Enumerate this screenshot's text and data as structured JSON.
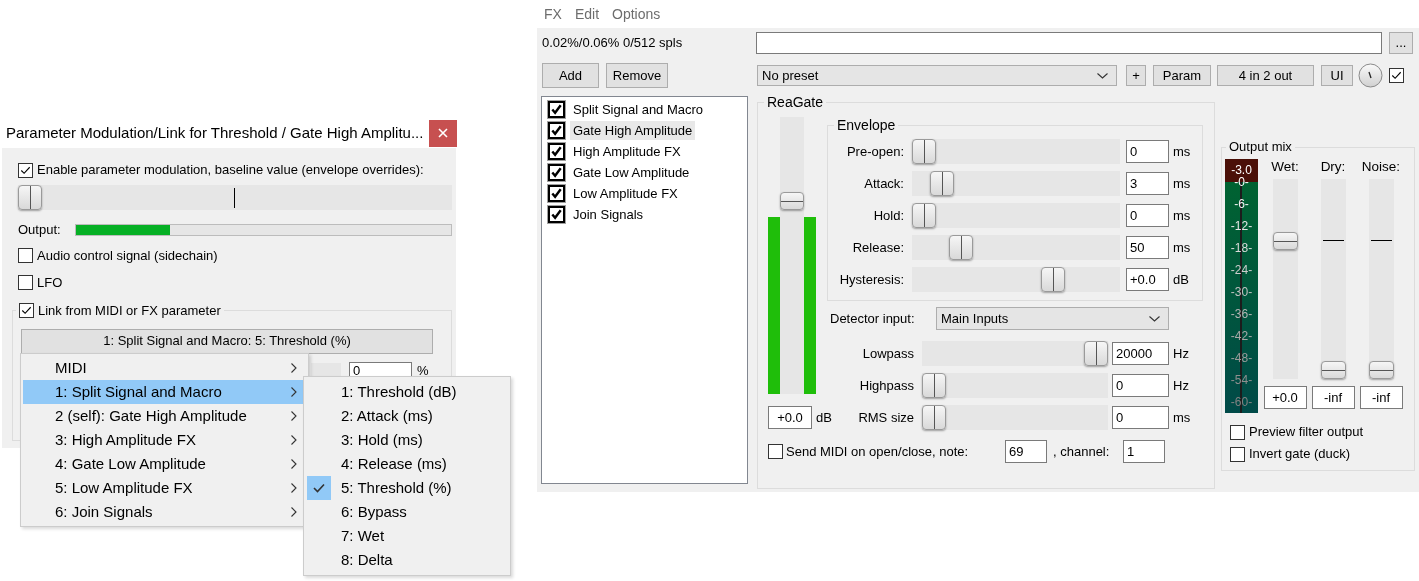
{
  "param_dialog": {
    "title": "Parameter Modulation/Link for Threshold / Gate High Amplitu...",
    "enable_modulation": {
      "label": "Enable parameter modulation, baseline value (envelope overrides):",
      "checked": true
    },
    "baseline": {
      "level": 0
    },
    "output": {
      "label": "Output:",
      "level": 0.25
    },
    "audio_control": {
      "label": "Audio control signal (sidechain)",
      "checked": false
    },
    "lfo": {
      "label": "LFO",
      "checked": false
    },
    "link": {
      "label": "Link from MIDI or FX parameter",
      "checked": true
    },
    "link_source_button": "1: Split Signal and Macro: 5: Threshold (%)",
    "offset": {
      "value": "0",
      "unit": "%"
    }
  },
  "link_menu": {
    "items": [
      {
        "label": "MIDI",
        "selected": false
      },
      {
        "label": "1: Split Signal and Macro",
        "selected": true
      },
      {
        "label": "2 (self): Gate High Amplitude",
        "selected": false
      },
      {
        "label": "3: High Amplitude FX",
        "selected": false
      },
      {
        "label": "4: Gate Low Amplitude",
        "selected": false
      },
      {
        "label": "5: Low Amplitude FX",
        "selected": false
      },
      {
        "label": "6: Join Signals",
        "selected": false
      }
    ]
  },
  "param_submenu": {
    "items": [
      {
        "label": "1: Threshold (dB)",
        "checked": false
      },
      {
        "label": "2: Attack (ms)",
        "checked": false
      },
      {
        "label": "3: Hold (ms)",
        "checked": false
      },
      {
        "label": "4: Release (ms)",
        "checked": false
      },
      {
        "label": "5: Threshold (%)",
        "checked": true
      },
      {
        "label": "6: Bypass",
        "checked": false
      },
      {
        "label": "7: Wet",
        "checked": false
      },
      {
        "label": "8: Delta",
        "checked": false
      }
    ]
  },
  "fx_window": {
    "menu": [
      "FX",
      "Edit",
      "Options"
    ],
    "cpu": "0.02%/0.06% 0/512 spls",
    "browse_button": "...",
    "add_button": "Add",
    "remove_button": "Remove",
    "preset": "No preset",
    "plus_button": "+",
    "param_button": "Param",
    "io_button": "4 in 2 out",
    "ui_button": "UI",
    "enabled": true,
    "fx_list": [
      {
        "name": "Split Signal and Macro",
        "enabled": true,
        "selected": false
      },
      {
        "name": "Gate High Amplitude",
        "enabled": true,
        "selected": true
      },
      {
        "name": "High Amplitude FX",
        "enabled": true,
        "selected": false
      },
      {
        "name": "Gate Low Amplitude",
        "enabled": true,
        "selected": false
      },
      {
        "name": "Low Amplitude FX",
        "enabled": true,
        "selected": false
      },
      {
        "name": "Join Signals",
        "enabled": true,
        "selected": false
      }
    ],
    "reagate": {
      "title": "ReaGate",
      "threshold": {
        "level": 0.71,
        "value": "+0.0",
        "unit": "dB"
      },
      "meters": [
        {
          "level": 0.64
        },
        {
          "level": 0.64
        }
      ],
      "envelope": {
        "title": "Envelope",
        "rows": [
          {
            "label": "Pre-open:",
            "level": 0,
            "value": "0",
            "unit": "ms"
          },
          {
            "label": "Attack:",
            "level": 0.1,
            "value": "3",
            "unit": "ms"
          },
          {
            "label": "Hold:",
            "level": 0,
            "value": "0",
            "unit": "ms"
          },
          {
            "label": "Release:",
            "level": 0.2,
            "value": "50",
            "unit": "ms"
          },
          {
            "label": "Hysteresis:",
            "level": 0.7,
            "value": "+0.0",
            "unit": "dB"
          }
        ]
      },
      "detector": {
        "label": "Detector input:",
        "value": "Main Inputs"
      },
      "filters": [
        {
          "label": "Lowpass",
          "level": 1,
          "value": "20000",
          "unit": "Hz"
        },
        {
          "label": "Highpass",
          "level": 0,
          "value": "0",
          "unit": "Hz"
        },
        {
          "label": "RMS size",
          "level": 0,
          "value": "0",
          "unit": "ms"
        }
      ],
      "send_midi": {
        "label": "Send MIDI on open/close, note:",
        "checked": false,
        "note": "69",
        "channel_label": ", channel:",
        "channel": "1"
      }
    },
    "output_mix": {
      "title": "Output mix",
      "meter": {
        "peak": "-3.0",
        "scale": [
          "-0-",
          "-6-",
          "-12-",
          "-18-",
          "-24-",
          "-30-",
          "-36-",
          "-42-",
          "-48-",
          "-54-",
          "-60-"
        ]
      },
      "faders": [
        {
          "label": "Wet:",
          "level": 0.71,
          "value": "+0.0"
        },
        {
          "label": "Dry:",
          "level": 0,
          "value": "-inf"
        },
        {
          "label": "Noise:",
          "level": 0,
          "value": "-inf"
        }
      ],
      "options": [
        {
          "label": "Preview filter output",
          "checked": false
        },
        {
          "label": "Invert gate (duck)",
          "checked": false
        }
      ]
    }
  }
}
